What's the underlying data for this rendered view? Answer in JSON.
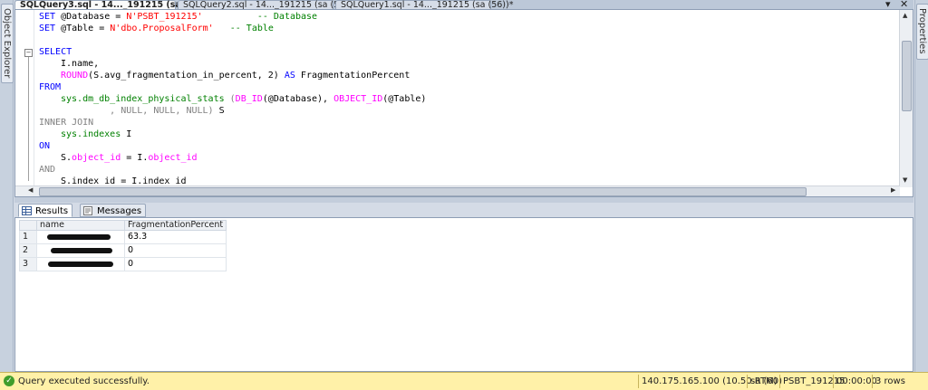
{
  "tabs": [
    {
      "label": "SQLQuery3.sql - 14..._191215 (sa (60))*",
      "active": true
    },
    {
      "label": "SQLQuery2.sql - 14..._191215 (sa (58))*",
      "active": false
    },
    {
      "label": "SQLQuery1.sql - 14..._191215 (sa (56))*",
      "active": false
    }
  ],
  "tab_controls": {
    "dropdown": "▾",
    "close": "✕"
  },
  "side_panels": {
    "left": "Object Explorer",
    "right": "Properties"
  },
  "editor": {
    "line1": {
      "kw": "SET",
      "var": " @Database = ",
      "str": "N'PSBT_191215'",
      "cm": "          -- Database"
    },
    "line2": {
      "kw": "SET",
      "var": " @Table = ",
      "str": "N'dbo.ProposalForm'",
      "cm": "   -- Table"
    },
    "select": "SELECT",
    "col1": "I.name,",
    "col2_fn": "ROUND",
    "col2_rest": "(S.avg_fragmentation_in_percent, 2) ",
    "col2_as": "AS",
    "col2_alias": " FragmentationPercent",
    "from": "FROM",
    "dmv": "sys.dm_db_index_physical_stats",
    "dmv_open": " (",
    "dbid_fn": "DB_ID",
    "dbid_arg": "(@Database), ",
    "objid_fn": "OBJECT_ID",
    "objid_arg": "(@Table)",
    "nulls": "         , NULL, NULL, NULL) ",
    "alias_s": "S",
    "inner_join": "INNER JOIN",
    "indexes": "sys.indexes",
    "alias_i": " I",
    "on": "ON",
    "cond1_a": "S.",
    "cond1_b": "object_id",
    "cond1_c": " = I.",
    "cond1_d": "object_id",
    "and": "AND",
    "cond2": "S.index_id = I.index_id"
  },
  "results_tabs": [
    {
      "label": "Results",
      "active": true
    },
    {
      "label": "Messages",
      "active": false
    }
  ],
  "grid": {
    "columns": [
      "name",
      "FragmentationPercent"
    ],
    "rows": [
      {
        "num": "1",
        "fragmentation": "63.3"
      },
      {
        "num": "2",
        "fragmentation": "0"
      },
      {
        "num": "3",
        "fragmentation": "0"
      }
    ]
  },
  "status": {
    "message": "Query executed successfully.",
    "server": "140.175.165.100 (10.50 RTM)",
    "user": "sa (60)",
    "database": "PSBT_191215",
    "elapsed": "00:00:00",
    "rows": "3 rows"
  },
  "colors": {
    "keyword": "#0000ff",
    "string": "#ff0000",
    "comment": "#008000",
    "function": "#ff00ff",
    "statusbar": "#fff1a8"
  }
}
